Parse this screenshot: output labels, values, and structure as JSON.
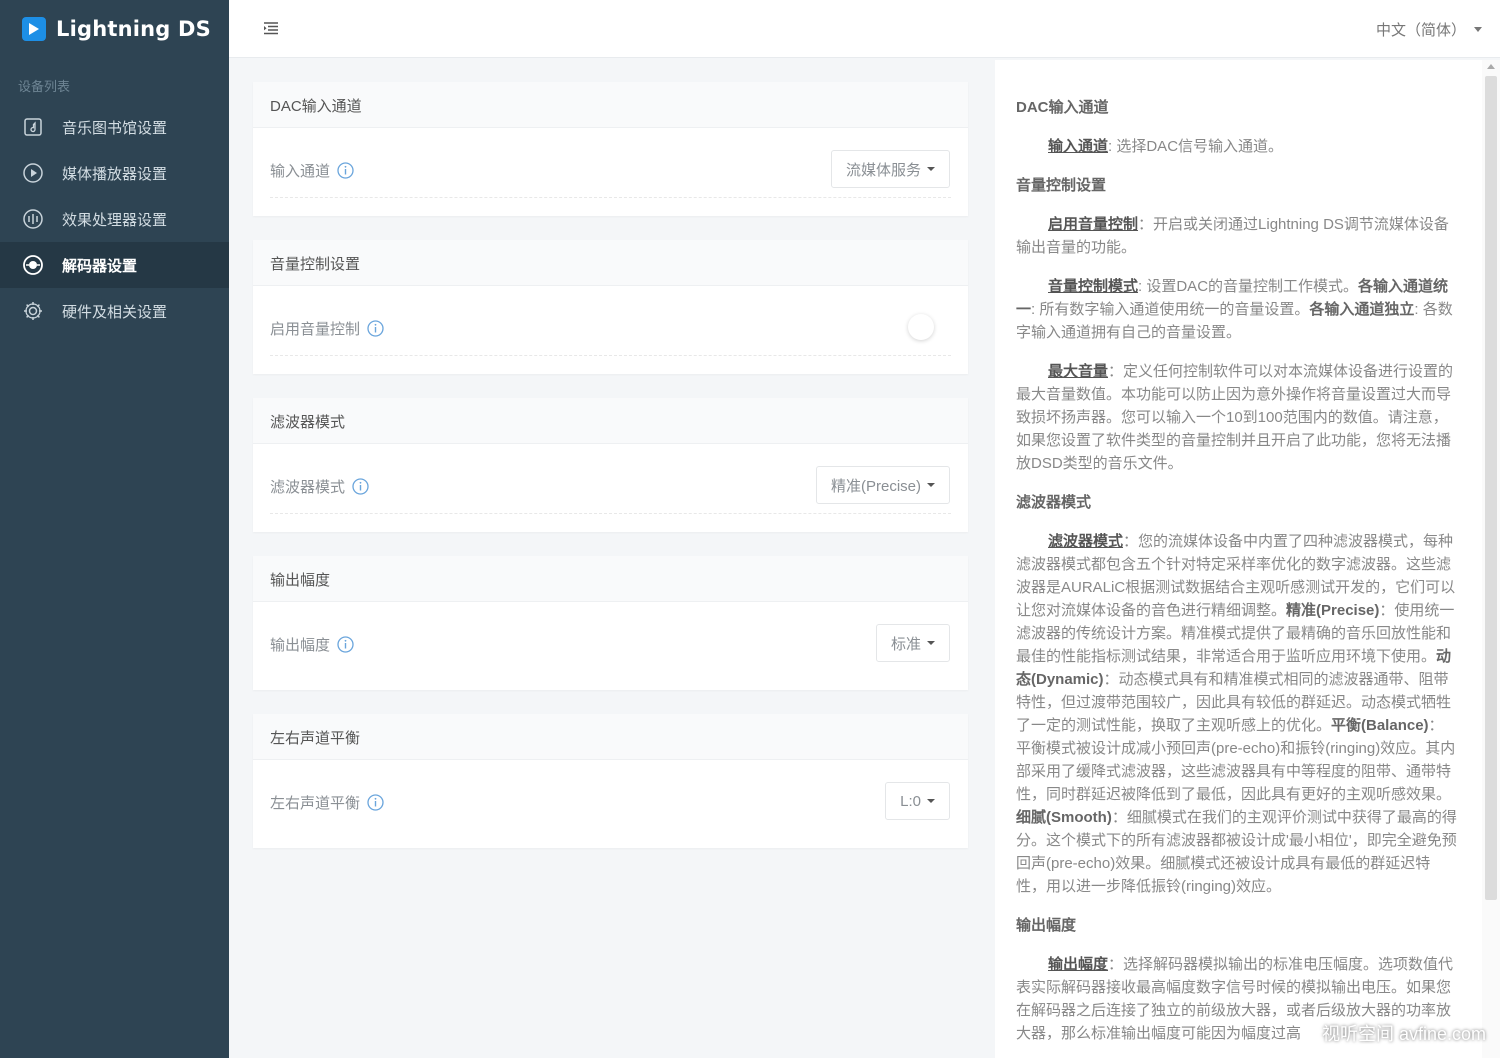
{
  "app": {
    "title": "Lightning DS"
  },
  "sidebar": {
    "section_title": "设备列表",
    "items": [
      {
        "label": "音乐图书馆设置",
        "icon": "music-library-icon"
      },
      {
        "label": "媒体播放器设置",
        "icon": "play-circle-icon"
      },
      {
        "label": "效果处理器设置",
        "icon": "equalizer-icon"
      },
      {
        "label": "解码器设置",
        "icon": "decoder-icon",
        "active": true
      },
      {
        "label": "硬件及相关设置",
        "icon": "gear-icon"
      }
    ]
  },
  "topbar": {
    "language": "中文（简体）"
  },
  "panels": [
    {
      "title": "DAC输入通道",
      "row_label": "输入通道",
      "control": "dropdown",
      "value": "流媒体服务"
    },
    {
      "title": "音量控制设置",
      "row_label": "启用音量控制",
      "control": "toggle",
      "enabled": false
    },
    {
      "title": "滤波器模式",
      "row_label": "滤波器模式",
      "control": "dropdown",
      "value": "精准(Precise)"
    },
    {
      "title": "输出幅度",
      "row_label": "输出幅度",
      "control": "dropdown",
      "value": "标准"
    },
    {
      "title": "左右声道平衡",
      "row_label": "左右声道平衡",
      "control": "dropdown",
      "value": "L:0"
    }
  ],
  "help": {
    "dac_title": "DAC输入通道",
    "dac_term": "输入通道",
    "dac_text": ": 选择DAC信号输入通道。",
    "vol_title": "音量控制设置",
    "vol_term1": "启用音量控制",
    "vol_text1": "：开启或关闭通过Lightning DS调节流媒体设备输出音量的功能。",
    "vol_term2": "音量控制模式",
    "vol_text2a": ": 设置DAC的音量控制工作模式。",
    "vol_bold2a": "各输入通道统一",
    "vol_text2b": ": 所有数字输入通道使用统一的音量设置。",
    "vol_bold2b": "各输入通道独立",
    "vol_text2c": ": 各数字输入通道拥有自己的音量设置。",
    "vol_term3": "最大音量",
    "vol_text3": "：定义任何控制软件可以对本流媒体设备进行设置的最大音量数值。本功能可以防止因为意外操作将音量设置过大而导致损坏扬声器。您可以输入一个10到100范围内的数值。请注意，如果您设置了软件类型的音量控制并且开启了此功能，您将无法播放DSD类型的音乐文件。",
    "filter_title": "滤波器模式",
    "filter_term": "滤波器模式",
    "filter_text1": "：您的流媒体设备中内置了四种滤波器模式，每种滤波器模式都包含五个针对特定采样率优化的数字滤波器。这些滤波器是AURALiC根据测试数据结合主观听感测试开发的，它们可以让您对流媒体设备的音色进行精细调整。",
    "filter_b1": "精准(Precise)",
    "filter_text2": "：使用统一滤波器的传统设计方案。精准模式提供了最精确的音乐回放性能和最佳的性能指标测试结果，非常适合用于监听应用环境下使用。",
    "filter_b2": "动态(Dynamic)",
    "filter_text3": "：动态模式具有和精准模式相同的滤波器通带、阻带特性，但过渡带范围较广，因此具有较低的群延迟。动态模式牺牲了一定的测试性能，换取了主观听感上的优化。",
    "filter_b3": "平衡(Balance)",
    "filter_text4": "：平衡模式被设计成减小预回声(pre-echo)和振铃(ringing)效应。其内部采用了缓降式滤波器，这些滤波器具有中等程度的阻带、通带特性，同时群延迟被降低到了最低，因此具有更好的主观听感效果。",
    "filter_b4": "细腻(Smooth)",
    "filter_text5": "：细腻模式在我们的主观评价测试中获得了最高的得分。这个模式下的所有滤波器都被设计成'最小相位'，即完全避免预回声(pre-echo)效果。细腻模式还被设计成具有最低的群延迟特性，用以进一步降低振铃(ringing)效应。",
    "out_title": "输出幅度",
    "out_term": "输出幅度",
    "out_text": "：选择解码器模拟输出的标准电压幅度。选项数值代表实际解码器接收最高幅度数字信号时候的模拟输出电压。如果您在解码器之后连接了独立的前级放大器，或者后级放大器的功率放大器，那么标准输出幅度可能因为幅度过高"
  },
  "watermark": "视听空间 avfine.com",
  "colors": {
    "sidebar": "#2e4453",
    "sidebar_active": "#253845",
    "accent": "#1d8fe6"
  }
}
